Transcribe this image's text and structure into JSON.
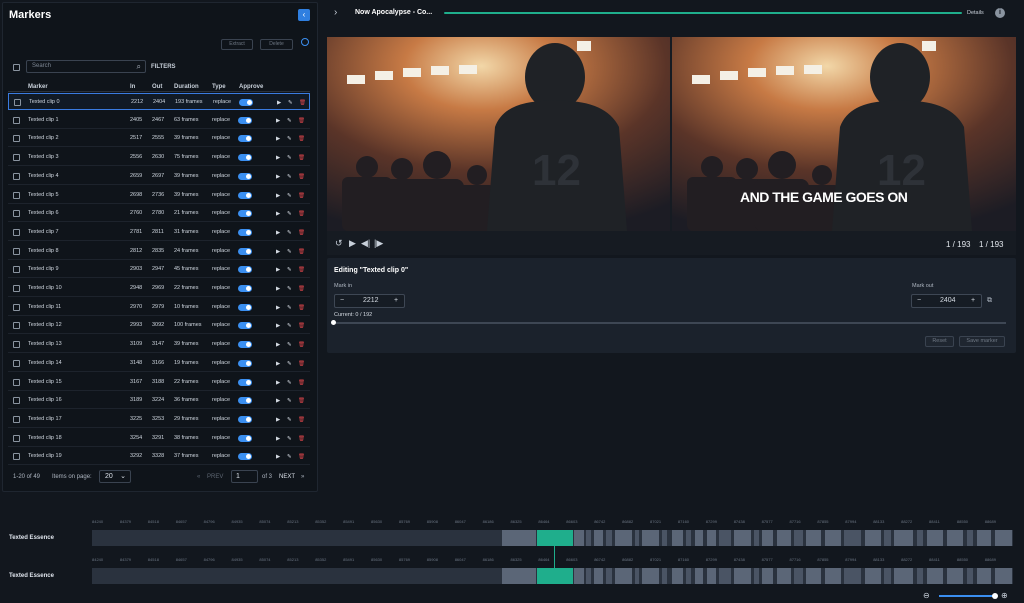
{
  "markers": {
    "title": "Markers",
    "extract_label": "Extract",
    "delete_label": "Delete",
    "search_placeholder": "Search",
    "filters_label": "FILTERS",
    "columns": [
      "Marker",
      "In",
      "Out",
      "Duration",
      "Type",
      "Approve"
    ],
    "rows": [
      {
        "name": "Texted clip 0",
        "in": "2212",
        "out": "2404",
        "duration": "193 frames",
        "type": "replace"
      },
      {
        "name": "Texted clip 1",
        "in": "2405",
        "out": "2467",
        "duration": "63 frames",
        "type": "replace"
      },
      {
        "name": "Texted clip 2",
        "in": "2517",
        "out": "2555",
        "duration": "39 frames",
        "type": "replace"
      },
      {
        "name": "Texted clip 3",
        "in": "2556",
        "out": "2630",
        "duration": "75 frames",
        "type": "replace"
      },
      {
        "name": "Texted clip 4",
        "in": "2659",
        "out": "2697",
        "duration": "39 frames",
        "type": "replace"
      },
      {
        "name": "Texted clip 5",
        "in": "2698",
        "out": "2736",
        "duration": "39 frames",
        "type": "replace"
      },
      {
        "name": "Texted clip 6",
        "in": "2760",
        "out": "2780",
        "duration": "21 frames",
        "type": "replace"
      },
      {
        "name": "Texted clip 7",
        "in": "2781",
        "out": "2811",
        "duration": "31 frames",
        "type": "replace"
      },
      {
        "name": "Texted clip 8",
        "in": "2812",
        "out": "2835",
        "duration": "24 frames",
        "type": "replace"
      },
      {
        "name": "Texted clip 9",
        "in": "2903",
        "out": "2947",
        "duration": "45 frames",
        "type": "replace"
      },
      {
        "name": "Texted clip 10",
        "in": "2948",
        "out": "2969",
        "duration": "22 frames",
        "type": "replace"
      },
      {
        "name": "Texted clip 11",
        "in": "2970",
        "out": "2979",
        "duration": "10 frames",
        "type": "replace"
      },
      {
        "name": "Texted clip 12",
        "in": "2993",
        "out": "3092",
        "duration": "100 frames",
        "type": "replace"
      },
      {
        "name": "Texted clip 13",
        "in": "3109",
        "out": "3147",
        "duration": "39 frames",
        "type": "replace"
      },
      {
        "name": "Texted clip 14",
        "in": "3148",
        "out": "3166",
        "duration": "19 frames",
        "type": "replace"
      },
      {
        "name": "Texted clip 15",
        "in": "3167",
        "out": "3188",
        "duration": "22 frames",
        "type": "replace"
      },
      {
        "name": "Texted clip 16",
        "in": "3189",
        "out": "3224",
        "duration": "36 frames",
        "type": "replace"
      },
      {
        "name": "Texted clip 17",
        "in": "3225",
        "out": "3253",
        "duration": "29 frames",
        "type": "replace"
      },
      {
        "name": "Texted clip 18",
        "in": "3254",
        "out": "3291",
        "duration": "38 frames",
        "type": "replace"
      },
      {
        "name": "Texted clip 19",
        "in": "3292",
        "out": "3328",
        "duration": "37 frames",
        "type": "replace"
      }
    ],
    "pager": {
      "range": "1-20 of 49",
      "items_label": "Items on page:",
      "items_value": "20",
      "prev": "PREV",
      "page": "1",
      "of": "of 3",
      "next": "NEXT"
    }
  },
  "top": {
    "project_title": "Now Apocalypse - Co...",
    "details": "Details"
  },
  "player": {
    "overlay_text": "AND THE GAME GOES ON",
    "counter_left": "1 / 193",
    "counter_right": "1 / 193"
  },
  "editing": {
    "title": "Editing \"Texted clip 0\"",
    "mark_in_label": "Mark in",
    "mark_in_value": "2212",
    "mark_out_label": "Mark out",
    "mark_out_value": "2404",
    "current": "Current: 0 / 192",
    "reset": "Reset",
    "save": "Save marker"
  },
  "timeline": {
    "track1": "Texted Essence",
    "track2": "Texted Essence",
    "ticks": [
      "84240",
      "84379",
      "84518",
      "84657",
      "84796",
      "84935",
      "85074",
      "85213",
      "85352",
      "85491",
      "85630",
      "85769",
      "85908",
      "86047",
      "86186",
      "86325",
      "86464",
      "86603",
      "86742",
      "86882",
      "87021",
      "87160",
      "87299",
      "87438",
      "87577",
      "87716",
      "87855",
      "87994",
      "88133",
      "88272",
      "88411",
      "88550",
      "88689"
    ]
  },
  "colors": {
    "accent": "#3b8ff0",
    "timeline_green": "#1fae8c",
    "delete_red": "#e0474c"
  }
}
